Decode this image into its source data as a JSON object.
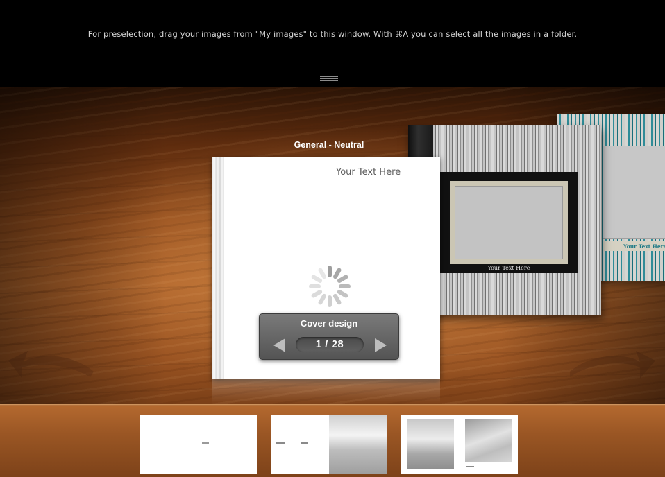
{
  "preselection": {
    "hint": "For preselection, drag your images from \"My images\" to this window. With ⌘A you can select all the images in a folder."
  },
  "carousel": {
    "current_design_title": "General - Neutral",
    "current_cover_text": "Your Text Here",
    "back_book_mid_text": "Your Text Here",
    "back_book_far_text": "Your Text Here"
  },
  "cover_panel": {
    "label": "Cover design",
    "page_counter": "1 / 28",
    "current_page": 1,
    "total_pages": 28
  },
  "colors": {
    "wood": "#a85c26",
    "panel": "#666666",
    "accent_teal": "#1f7a86"
  },
  "icons": {
    "grip": "resize-grip-icon",
    "prev": "triangle-left-icon",
    "next": "triangle-right-icon",
    "rotate_left": "curved-arrow-left-icon",
    "rotate_right": "curved-arrow-right-icon",
    "loading": "spinner-icon"
  }
}
